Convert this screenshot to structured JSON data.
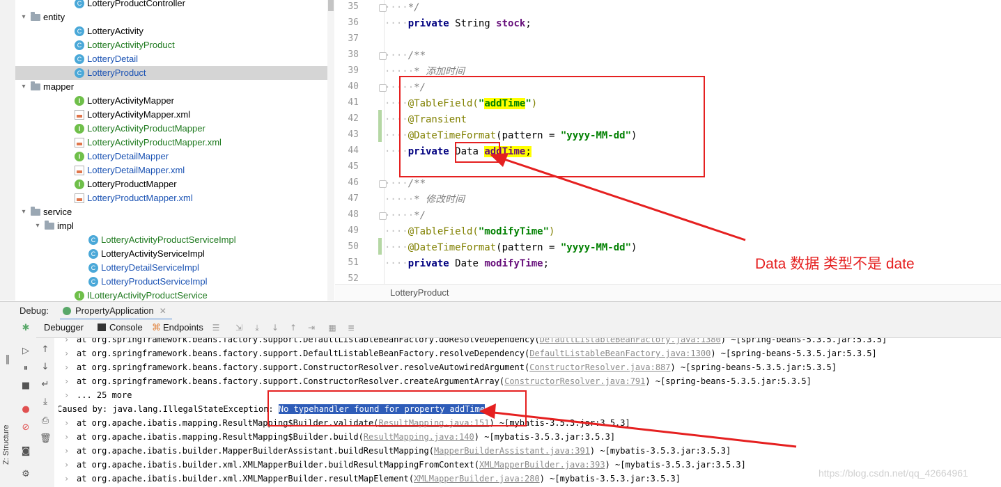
{
  "project_tree": {
    "rows": [
      {
        "label": "LotteryProductController",
        "icon": "class-icon",
        "color": "plain",
        "selected": false,
        "expanded": null
      },
      {
        "label": "entity",
        "icon": "folder-icon",
        "color": "plain",
        "selected": false,
        "expanded": true
      },
      {
        "label": "LotteryActivity",
        "icon": "class-icon",
        "color": "plain",
        "selected": false,
        "expanded": null
      },
      {
        "label": "LotteryActivityProduct",
        "icon": "class-icon",
        "color": "green",
        "selected": false,
        "expanded": null
      },
      {
        "label": "LotteryDetail",
        "icon": "class-icon",
        "color": "blue",
        "selected": false,
        "expanded": null
      },
      {
        "label": "LotteryProduct",
        "icon": "class-icon",
        "color": "blue",
        "selected": true,
        "expanded": null
      },
      {
        "label": "mapper",
        "icon": "folder-icon",
        "color": "plain",
        "selected": false,
        "expanded": true
      },
      {
        "label": "LotteryActivityMapper",
        "icon": "interface-icon",
        "color": "plain",
        "selected": false,
        "expanded": null
      },
      {
        "label": "LotteryActivityMapper.xml",
        "icon": "xml-file-icon",
        "color": "plain",
        "selected": false,
        "expanded": null
      },
      {
        "label": "LotteryActivityProductMapper",
        "icon": "interface-icon",
        "color": "green",
        "selected": false,
        "expanded": null
      },
      {
        "label": "LotteryActivityProductMapper.xml",
        "icon": "xml-file-icon",
        "color": "green",
        "selected": false,
        "expanded": null
      },
      {
        "label": "LotteryDetailMapper",
        "icon": "interface-icon",
        "color": "blue",
        "selected": false,
        "expanded": null
      },
      {
        "label": "LotteryDetailMapper.xml",
        "icon": "xml-file-icon",
        "color": "blue",
        "selected": false,
        "expanded": null
      },
      {
        "label": "LotteryProductMapper",
        "icon": "interface-icon",
        "color": "plain",
        "selected": false,
        "expanded": null
      },
      {
        "label": "LotteryProductMapper.xml",
        "icon": "xml-file-icon",
        "color": "blue",
        "selected": false,
        "expanded": null
      },
      {
        "label": "service",
        "icon": "folder-icon",
        "color": "plain",
        "selected": false,
        "expanded": true
      },
      {
        "label": "impl",
        "icon": "folder-icon",
        "color": "plain",
        "selected": false,
        "expanded": true
      },
      {
        "label": "LotteryActivityProductServiceImpl",
        "icon": "class-icon",
        "color": "green",
        "selected": false,
        "expanded": null
      },
      {
        "label": "LotteryActivityServiceImpl",
        "icon": "class-icon",
        "color": "plain",
        "selected": false,
        "expanded": null
      },
      {
        "label": "LotteryDetailServiceImpl",
        "icon": "class-icon",
        "color": "blue",
        "selected": false,
        "expanded": null
      },
      {
        "label": "LotteryProductServiceImpl",
        "icon": "class-icon",
        "color": "blue",
        "selected": false,
        "expanded": null
      },
      {
        "label": "ILotteryActivityProductService",
        "icon": "interface-icon",
        "color": "green",
        "selected": false,
        "expanded": null
      }
    ]
  },
  "editor": {
    "line_numbers": [
      "35",
      "36",
      "37",
      "38",
      "39",
      "40",
      "41",
      "42",
      "43",
      "44",
      "45",
      "46",
      "47",
      "48",
      "49",
      "50",
      "51",
      "52"
    ],
    "breadcrumb": "LotteryProduct",
    "lines": [
      {
        "dots": "····",
        "parts": [
          {
            "t": "*/",
            "c": "cm"
          }
        ]
      },
      {
        "dots": "····",
        "parts": [
          {
            "t": "private",
            "c": "kw"
          },
          {
            "t": " String ",
            "c": "ty"
          },
          {
            "t": "stock",
            "c": "fld"
          },
          {
            "t": ";",
            "c": "ty"
          }
        ]
      },
      {
        "dots": "",
        "parts": []
      },
      {
        "dots": "····",
        "parts": [
          {
            "t": "/**",
            "c": "cm"
          }
        ]
      },
      {
        "dots": "·····",
        "parts": [
          {
            "t": "* 添加时间",
            "c": "cm"
          }
        ]
      },
      {
        "dots": "·····",
        "parts": [
          {
            "t": "*/",
            "c": "cm"
          }
        ]
      },
      {
        "dots": "····",
        "parts": [
          {
            "t": "@TableField(",
            "c": "ann"
          },
          {
            "t": "\"",
            "c": "str"
          },
          {
            "t": "addTime",
            "c": "str hlstr"
          },
          {
            "t": "\"",
            "c": "str"
          },
          {
            "t": ")",
            "c": "ann"
          }
        ]
      },
      {
        "dots": "····",
        "parts": [
          {
            "t": "@Transient",
            "c": "ann"
          }
        ]
      },
      {
        "dots": "····",
        "parts": [
          {
            "t": "@DateTimeFormat",
            "c": "ann"
          },
          {
            "t": "(pattern = ",
            "c": "ty"
          },
          {
            "t": "\"yyyy-MM-dd\"",
            "c": "str"
          },
          {
            "t": ")",
            "c": "ty"
          }
        ]
      },
      {
        "dots": "····",
        "parts": [
          {
            "t": "private",
            "c": "kw"
          },
          {
            "t": " Data ",
            "c": "ty"
          },
          {
            "t": "addTime",
            "c": "fld hl"
          },
          {
            "t": ";",
            "c": "ty hl"
          }
        ]
      },
      {
        "dots": "",
        "parts": []
      },
      {
        "dots": "····",
        "parts": [
          {
            "t": "/**",
            "c": "cm"
          }
        ]
      },
      {
        "dots": "·····",
        "parts": [
          {
            "t": "* 修改时间",
            "c": "cm"
          }
        ]
      },
      {
        "dots": "·····",
        "parts": [
          {
            "t": "*/",
            "c": "cm"
          }
        ]
      },
      {
        "dots": "····",
        "parts": [
          {
            "t": "@TableField(",
            "c": "ann"
          },
          {
            "t": "\"modifyTime\"",
            "c": "str"
          },
          {
            "t": ")",
            "c": "ann"
          }
        ]
      },
      {
        "dots": "····",
        "parts": [
          {
            "t": "@DateTimeFormat",
            "c": "ann"
          },
          {
            "t": "(pattern = ",
            "c": "ty"
          },
          {
            "t": "\"yyyy-MM-dd\"",
            "c": "str"
          },
          {
            "t": ")",
            "c": "ty"
          }
        ]
      },
      {
        "dots": "····",
        "parts": [
          {
            "t": "private",
            "c": "kw"
          },
          {
            "t": " Date ",
            "c": "ty"
          },
          {
            "t": "modifyTime",
            "c": "fld"
          },
          {
            "t": ";",
            "c": "ty"
          }
        ]
      },
      {
        "dots": "",
        "parts": []
      }
    ]
  },
  "annotation": {
    "text": "Data 数据 类型不是 date",
    "color": "#e52020"
  },
  "debug": {
    "title": "Debug:",
    "run_config": "PropertyApplication",
    "tabs": {
      "debugger": "Debugger",
      "console": "Console",
      "endpoints": "Endpoints"
    },
    "structure_label": "Z: Structure",
    "console_lines": [
      {
        "chev": true,
        "pre": "at org.springframework.beans.factory.support.DefaultListableBeanFactory.doResolveDependency(",
        "link": "DefaultListableBeanFactory.java:1380",
        "post": ") ~[spring-beans-5.3.5.jar:5.3.5]",
        "sel": ""
      },
      {
        "chev": true,
        "pre": "at org.springframework.beans.factory.support.DefaultListableBeanFactory.resolveDependency(",
        "link": "DefaultListableBeanFactory.java:1300",
        "post": ") ~[spring-beans-5.3.5.jar:5.3.5]",
        "sel": ""
      },
      {
        "chev": true,
        "pre": "at org.springframework.beans.factory.support.ConstructorResolver.resolveAutowiredArgument(",
        "link": "ConstructorResolver.java:887",
        "post": ") ~[spring-beans-5.3.5.jar:5.3.5]",
        "sel": ""
      },
      {
        "chev": true,
        "pre": "at org.springframework.beans.factory.support.ConstructorResolver.createArgumentArray(",
        "link": "ConstructorResolver.java:791",
        "post": ") ~[spring-beans-5.3.5.jar:5.3.5]",
        "sel": ""
      },
      {
        "chev": true,
        "pre": "... 25 more",
        "link": "",
        "post": "",
        "sel": ""
      },
      {
        "chev": false,
        "pre": "Caused by: java.lang.IllegalStateException: ",
        "link": "",
        "post": "",
        "sel": "No typehandler found for property addTime"
      },
      {
        "chev": true,
        "pre": "at org.apache.ibatis.mapping.ResultMapping$Builder.validate(",
        "link": "ResultMapping.java:151",
        "post": ") ~[mybatis-3.5.3.jar:3.5.3]",
        "sel": ""
      },
      {
        "chev": true,
        "pre": "at org.apache.ibatis.mapping.ResultMapping$Builder.build(",
        "link": "ResultMapping.java:140",
        "post": ") ~[mybatis-3.5.3.jar:3.5.3]",
        "sel": ""
      },
      {
        "chev": true,
        "pre": "at org.apache.ibatis.builder.MapperBuilderAssistant.buildResultMapping(",
        "link": "MapperBuilderAssistant.java:391",
        "post": ") ~[mybatis-3.5.3.jar:3.5.3]",
        "sel": ""
      },
      {
        "chev": true,
        "pre": "at org.apache.ibatis.builder.xml.XMLMapperBuilder.buildResultMappingFromContext(",
        "link": "XMLMapperBuilder.java:393",
        "post": ") ~[mybatis-3.5.3.jar:3.5.3]",
        "sel": ""
      },
      {
        "chev": true,
        "pre": "at org.apache.ibatis.builder.xml.XMLMapperBuilder.resultMapElement(",
        "link": "XMLMapperBuilder.java:280",
        "post": ") ~[mybatis-3.5.3.jar:3.5.3]",
        "sel": ""
      }
    ]
  },
  "watermark": "https://blog.csdn.net/qq_42664961"
}
